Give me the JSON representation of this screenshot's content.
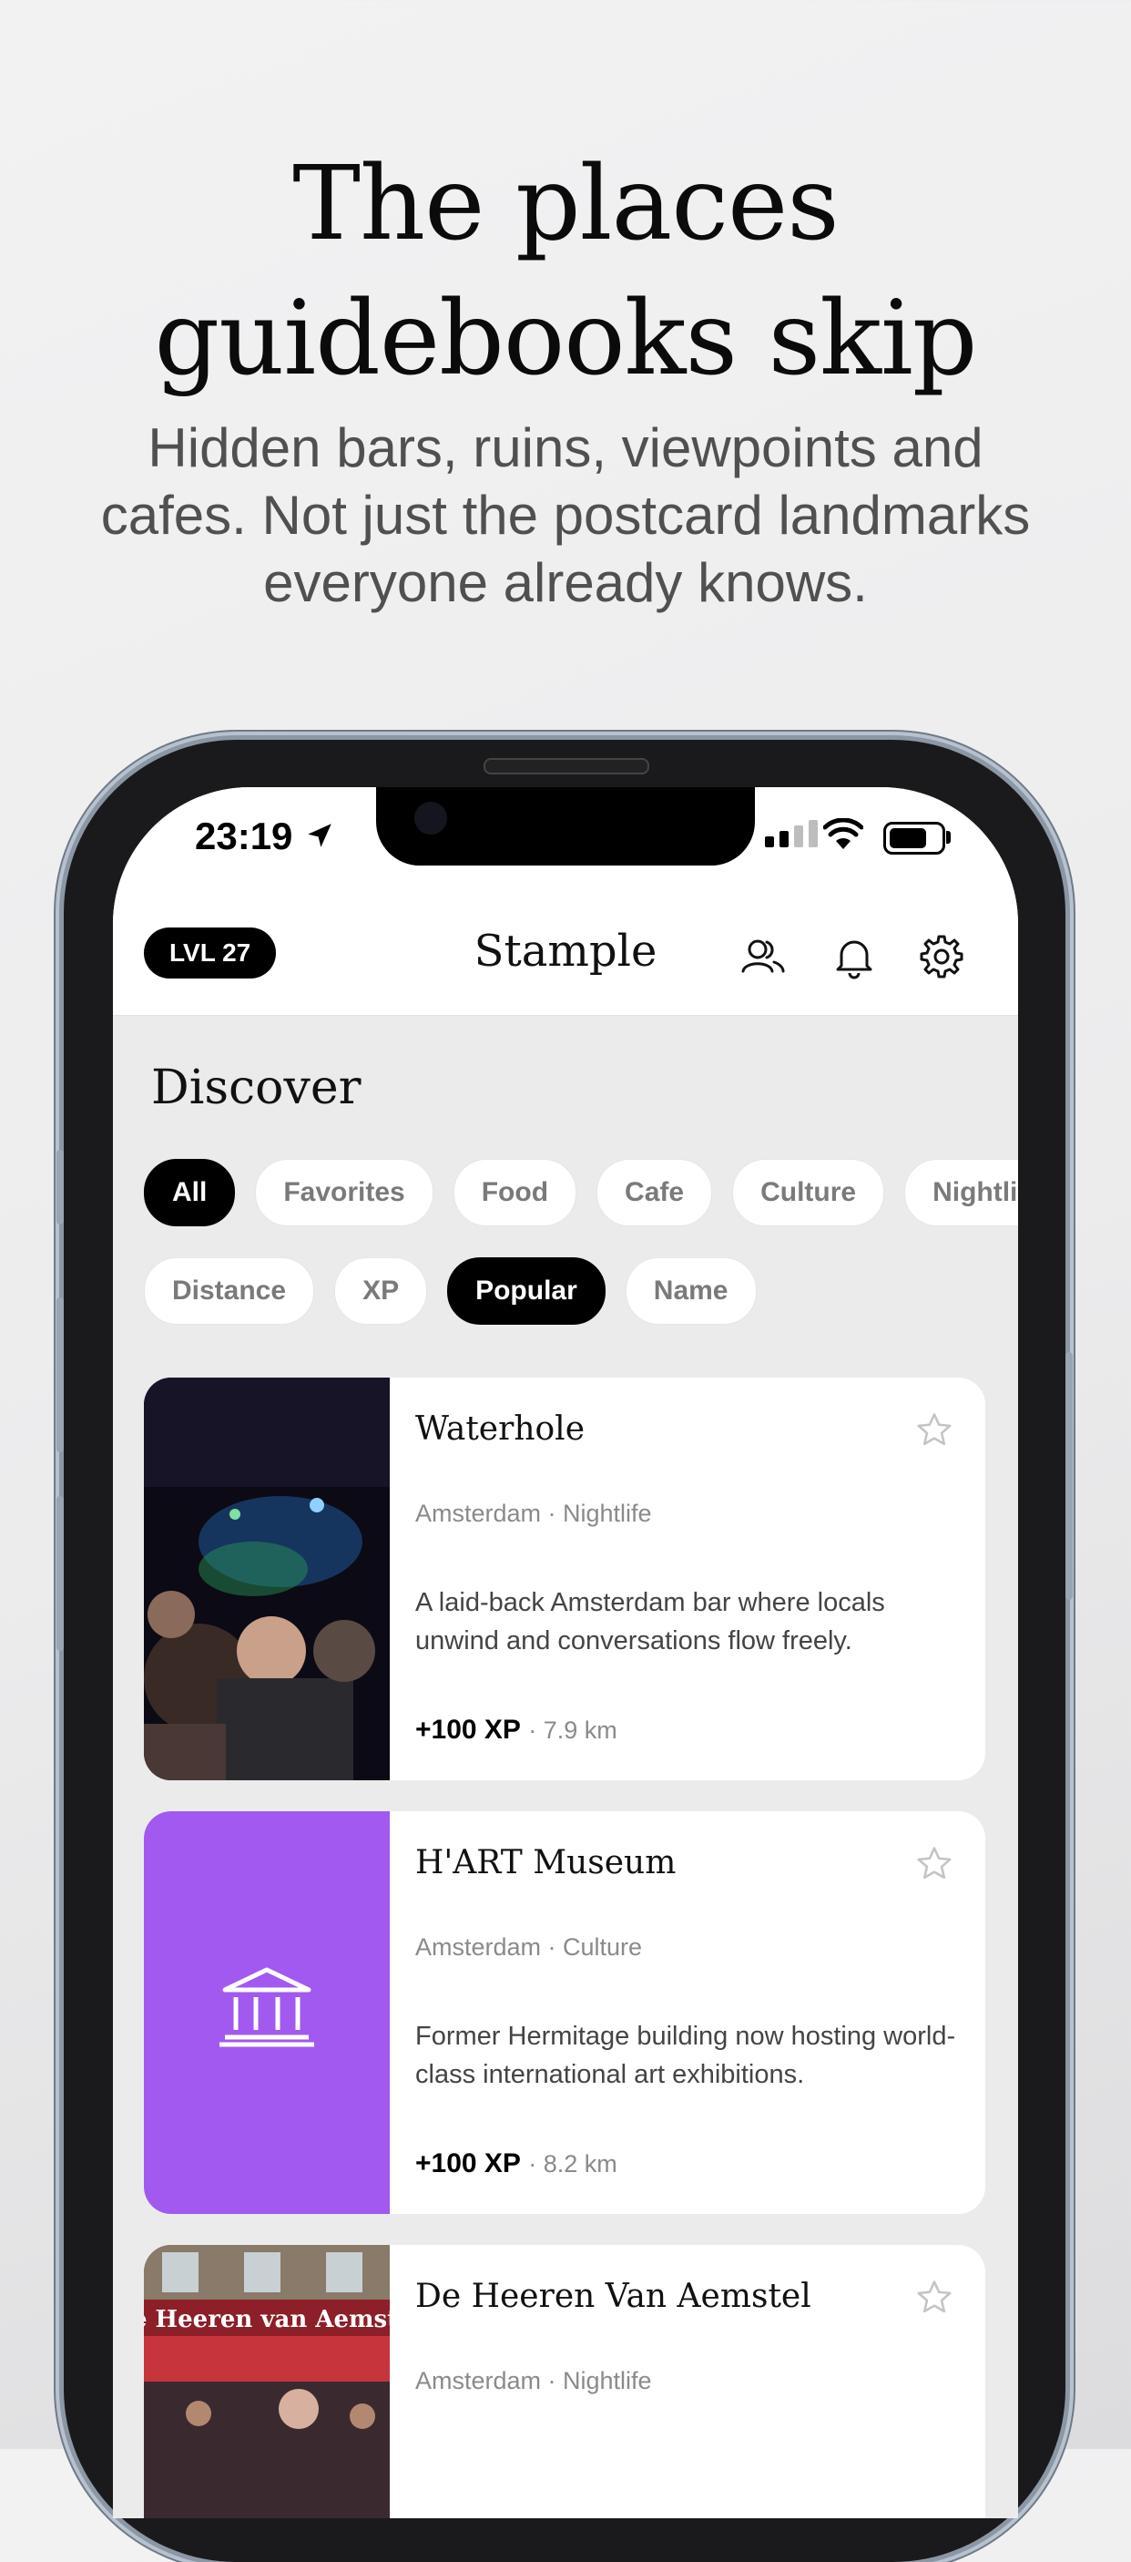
{
  "headline": {
    "line1": "The places",
    "line2": "guidebooks skip",
    "sub": "Hidden bars, ruins, viewpoints and cafes. Not just the postcard landmarks everyone already knows."
  },
  "status": {
    "time": "23:19"
  },
  "appbar": {
    "level": "LVL 27",
    "brand": "Stample",
    "icons": [
      "friends-icon",
      "bell-icon",
      "gear-icon"
    ]
  },
  "discover": {
    "title": "Discover"
  },
  "filters": [
    "All",
    "Favorites",
    "Food",
    "Cafe",
    "Culture",
    "Nightlife"
  ],
  "sort": [
    "Distance",
    "XP",
    "Popular",
    "Name"
  ],
  "cards": [
    {
      "title": "Waterhole",
      "meta": "Amsterdam · Nightlife",
      "desc": "A laid-back Amsterdam bar where locals unwind and conversations flow freely.",
      "xp": "+100 XP",
      "distance": "· 7.9 km"
    },
    {
      "title": "H'ART Museum",
      "meta": "Amsterdam · Culture",
      "desc": "Former Hermitage building now hosting world-class international art exhibitions.",
      "xp": "+100 XP",
      "distance": "· 8.2 km",
      "thumb_color": "#a259f0"
    },
    {
      "title": "De Heeren Van Aemstel",
      "meta": "Amsterdam · Nightlife",
      "sign_text": "De Heeren van Aemstel"
    }
  ]
}
